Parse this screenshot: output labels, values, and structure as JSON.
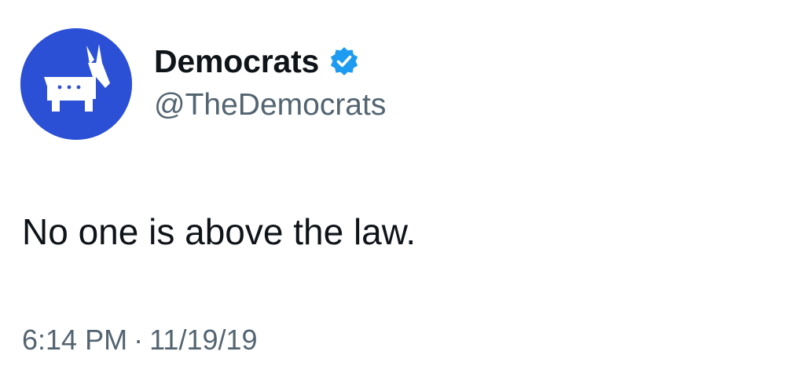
{
  "author": {
    "display_name": "Democrats",
    "handle": "@TheDemocrats",
    "verified": true,
    "avatar_icon": "donkey-logo-icon",
    "avatar_color": "#2b50d6",
    "verified_color": "#1d9bf0"
  },
  "tweet": {
    "text": "No one is above the law."
  },
  "meta": {
    "time": "6:14 PM",
    "separator": "·",
    "date": "11/19/19"
  }
}
